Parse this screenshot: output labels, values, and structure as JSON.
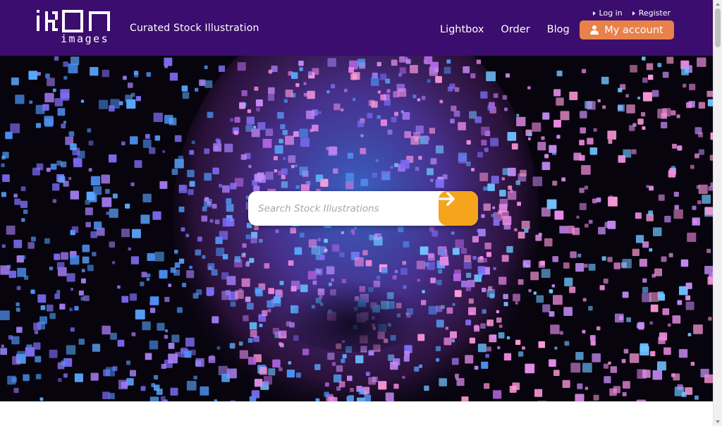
{
  "brand": {
    "logo_word": "IKON",
    "logo_sub": "images",
    "tagline": "Curated Stock Illustration",
    "header_color": "#3a0d6e"
  },
  "top_links": [
    {
      "label": "Log in"
    },
    {
      "label": "Register"
    }
  ],
  "nav": [
    {
      "label": "Lightbox"
    },
    {
      "label": "Order"
    },
    {
      "label": "Blog"
    }
  ],
  "account": {
    "label": "My account",
    "icon": "user-icon",
    "color": "#e8814a"
  },
  "search": {
    "placeholder": "Search Stock Illustrations",
    "value": "",
    "button_icon": "arrow-right-icon",
    "button_color": "#f5a41c"
  },
  "hero": {
    "image": "digital-face-of-glowing-cubes"
  }
}
